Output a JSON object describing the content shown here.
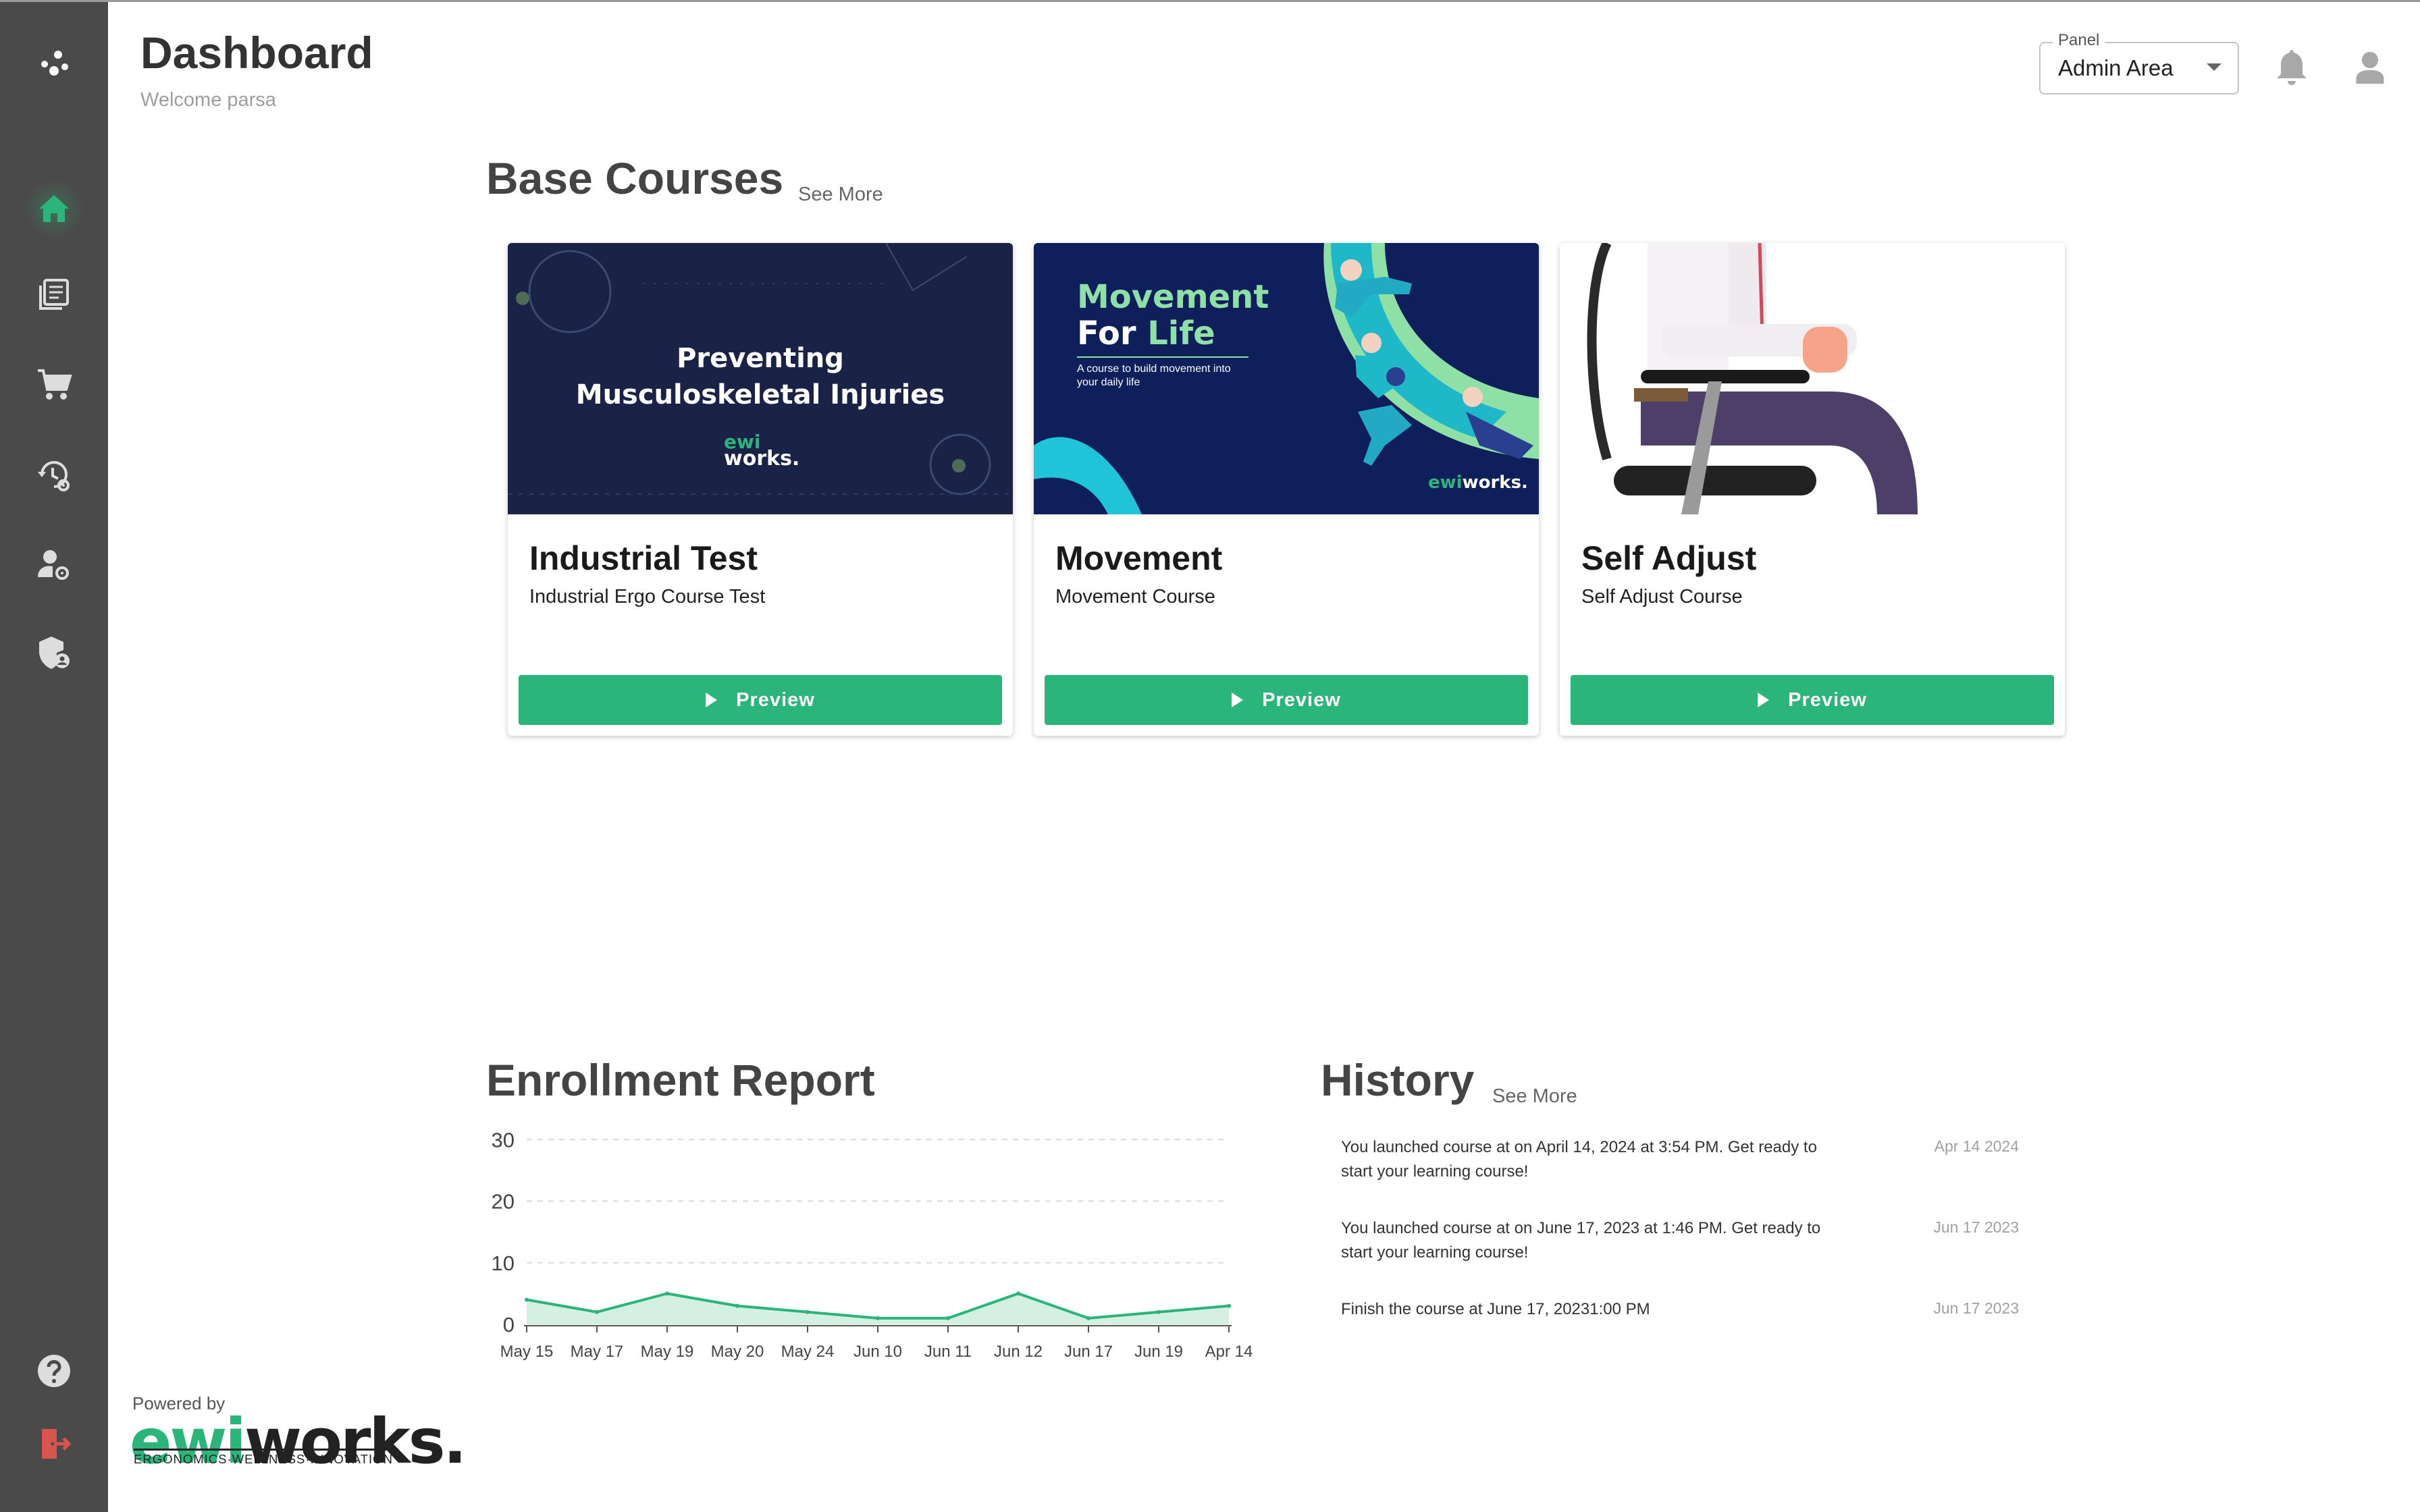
{
  "header": {
    "title": "Dashboard",
    "welcome": "Welcome parsa",
    "panel_label": "Panel",
    "panel_value": "Admin Area"
  },
  "sidebar": {
    "items": [
      {
        "icon": "home-icon",
        "active": true
      },
      {
        "icon": "courses-icon"
      },
      {
        "icon": "cart-icon"
      },
      {
        "icon": "history-settings-icon"
      },
      {
        "icon": "user-settings-icon"
      },
      {
        "icon": "shield-user-icon"
      }
    ],
    "bottom": [
      {
        "icon": "help-icon"
      },
      {
        "icon": "logout-icon"
      }
    ]
  },
  "base_courses": {
    "title": "Base Courses",
    "see_more": "See More",
    "cards": [
      {
        "title": "Industrial Test",
        "subtitle": "Industrial Ergo Course Test",
        "button": "Preview",
        "image_text_1": "Preventing",
        "image_text_2": "Musculoskeletal Injuries",
        "image_logo_1": "ewi",
        "image_logo_2": "works."
      },
      {
        "title": "Movement",
        "subtitle": "Movement Course",
        "button": "Preview",
        "image_text_1": "Movement",
        "image_text_2a": "For ",
        "image_text_2b": "Life",
        "image_text_3": "A course to build movement into",
        "image_text_4": "your daily life",
        "image_logo_1": "ewi",
        "image_logo_2": "works."
      },
      {
        "title": "Self Adjust",
        "subtitle": "Self Adjust Course",
        "button": "Preview"
      }
    ]
  },
  "enrollment": {
    "title": "Enrollment Report"
  },
  "chart_data": {
    "type": "area",
    "title": "Enrollment Report",
    "categories": [
      "May 15",
      "May 17",
      "May 19",
      "May 20",
      "May 24",
      "Jun 10",
      "Jun 11",
      "Jun 12",
      "Jun 17",
      "Jun 19",
      "Apr 14"
    ],
    "values": [
      4,
      2,
      5,
      3,
      2,
      1,
      1,
      5,
      1,
      2,
      3
    ],
    "yticks": [
      0,
      10,
      20,
      30
    ],
    "ylim": [
      0,
      32
    ],
    "grid": true,
    "colors": {
      "line": "#2bb57a",
      "fill": "#c9ecdb"
    }
  },
  "history": {
    "title": "History",
    "see_more": "See More",
    "items": [
      {
        "text": "You launched course at on April 14, 2024 at 3:54 PM. Get ready to start your learning course!",
        "date": "Apr 14 2024"
      },
      {
        "text": "You launched course at on June 17, 2023 at 1:46 PM. Get ready to start your learning course!",
        "date": "Jun 17 2023"
      },
      {
        "text": "Finish the course at June 17, 20231:00 PM",
        "date": "Jun 17 2023"
      }
    ]
  },
  "footer": {
    "powered_by": "Powered by",
    "logo_ewi": "ewi",
    "logo_works": "works.",
    "tagline": "ERGONOMICS·WELLNESS·INNOVATION"
  },
  "colors": {
    "accent": "#2bb57a",
    "sidebar": "#4a4a4a",
    "logout": "#d9534f"
  }
}
